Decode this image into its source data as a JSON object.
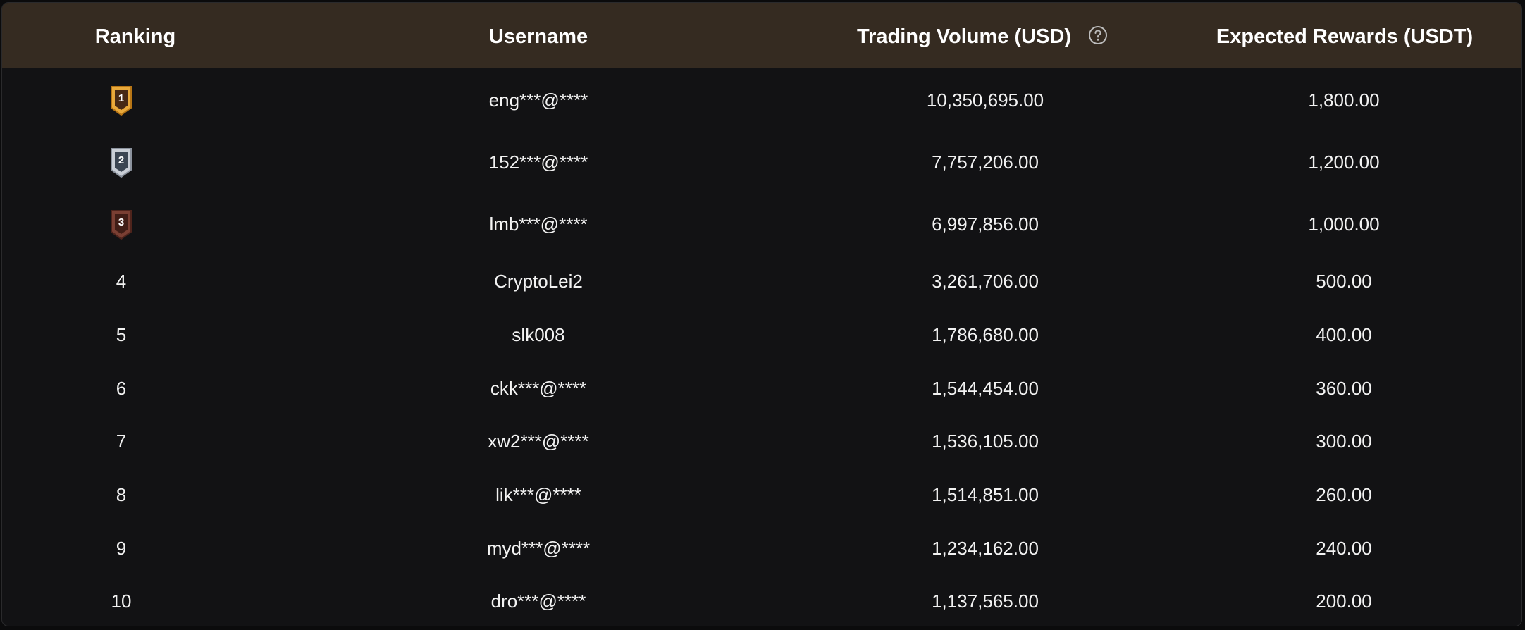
{
  "table": {
    "columns": {
      "ranking": "Ranking",
      "username": "Username",
      "volume": "Trading Volume (USD)",
      "rewards": "Expected Rewards (USDT)"
    },
    "help_icon": "question-circle-icon",
    "medals": {
      "gold": "#e9a93b",
      "silver": "#c9ced6",
      "bronze": "#7a3f33"
    },
    "rows": [
      {
        "rank": "1",
        "medal": "gold-medal-icon",
        "username": "eng***@****",
        "volume": "10,350,695.00",
        "reward": "1,800.00"
      },
      {
        "rank": "2",
        "medal": "silver-medal-icon",
        "username": "152***@****",
        "volume": "7,757,206.00",
        "reward": "1,200.00"
      },
      {
        "rank": "3",
        "medal": "bronze-medal-icon",
        "username": "lmb***@****",
        "volume": "6,997,856.00",
        "reward": "1,000.00"
      },
      {
        "rank": "4",
        "username": "CryptoLei2",
        "volume": "3,261,706.00",
        "reward": "500.00"
      },
      {
        "rank": "5",
        "username": "slk008",
        "volume": "1,786,680.00",
        "reward": "400.00"
      },
      {
        "rank": "6",
        "username": "ckk***@****",
        "volume": "1,544,454.00",
        "reward": "360.00"
      },
      {
        "rank": "7",
        "username": "xw2***@****",
        "volume": "1,536,105.00",
        "reward": "300.00"
      },
      {
        "rank": "8",
        "username": "lik***@****",
        "volume": "1,514,851.00",
        "reward": "260.00"
      },
      {
        "rank": "9",
        "username": "myd***@****",
        "volume": "1,234,162.00",
        "reward": "240.00"
      },
      {
        "rank": "10",
        "username": "dro***@****",
        "volume": "1,137,565.00",
        "reward": "200.00"
      }
    ]
  }
}
